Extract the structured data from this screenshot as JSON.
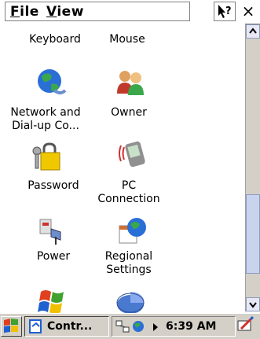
{
  "menu": {
    "file": "File",
    "view": "View",
    "help_icon": "help-arrow-icon",
    "close": "×"
  },
  "items": [
    {
      "label": "Keyboard",
      "icon": "keyboard-icon"
    },
    {
      "label": "Mouse",
      "icon": "mouse-icon"
    },
    {
      "label": "Network and\nDial-up Co...",
      "icon": "globe-network-icon"
    },
    {
      "label": "Owner",
      "icon": "people-icon"
    },
    {
      "label": "Password",
      "icon": "padlock-keys-icon"
    },
    {
      "label": "PC\nConnection",
      "icon": "pda-connection-icon"
    },
    {
      "label": "Power",
      "icon": "power-plug-icon"
    },
    {
      "label": "Regional\nSettings",
      "icon": "calendar-globe-icon"
    },
    {
      "label": "",
      "icon": "windows-flag-icon"
    },
    {
      "label": "",
      "icon": "pie-chart-icon"
    }
  ],
  "taskbar": {
    "start_icon": "windows-flag-icon",
    "task_label": "Contr...",
    "clock": "6:39 AM"
  },
  "colors": {
    "taskbar_bg": "#d4d0c8",
    "scroll_thumb": "#c8d4ee"
  }
}
